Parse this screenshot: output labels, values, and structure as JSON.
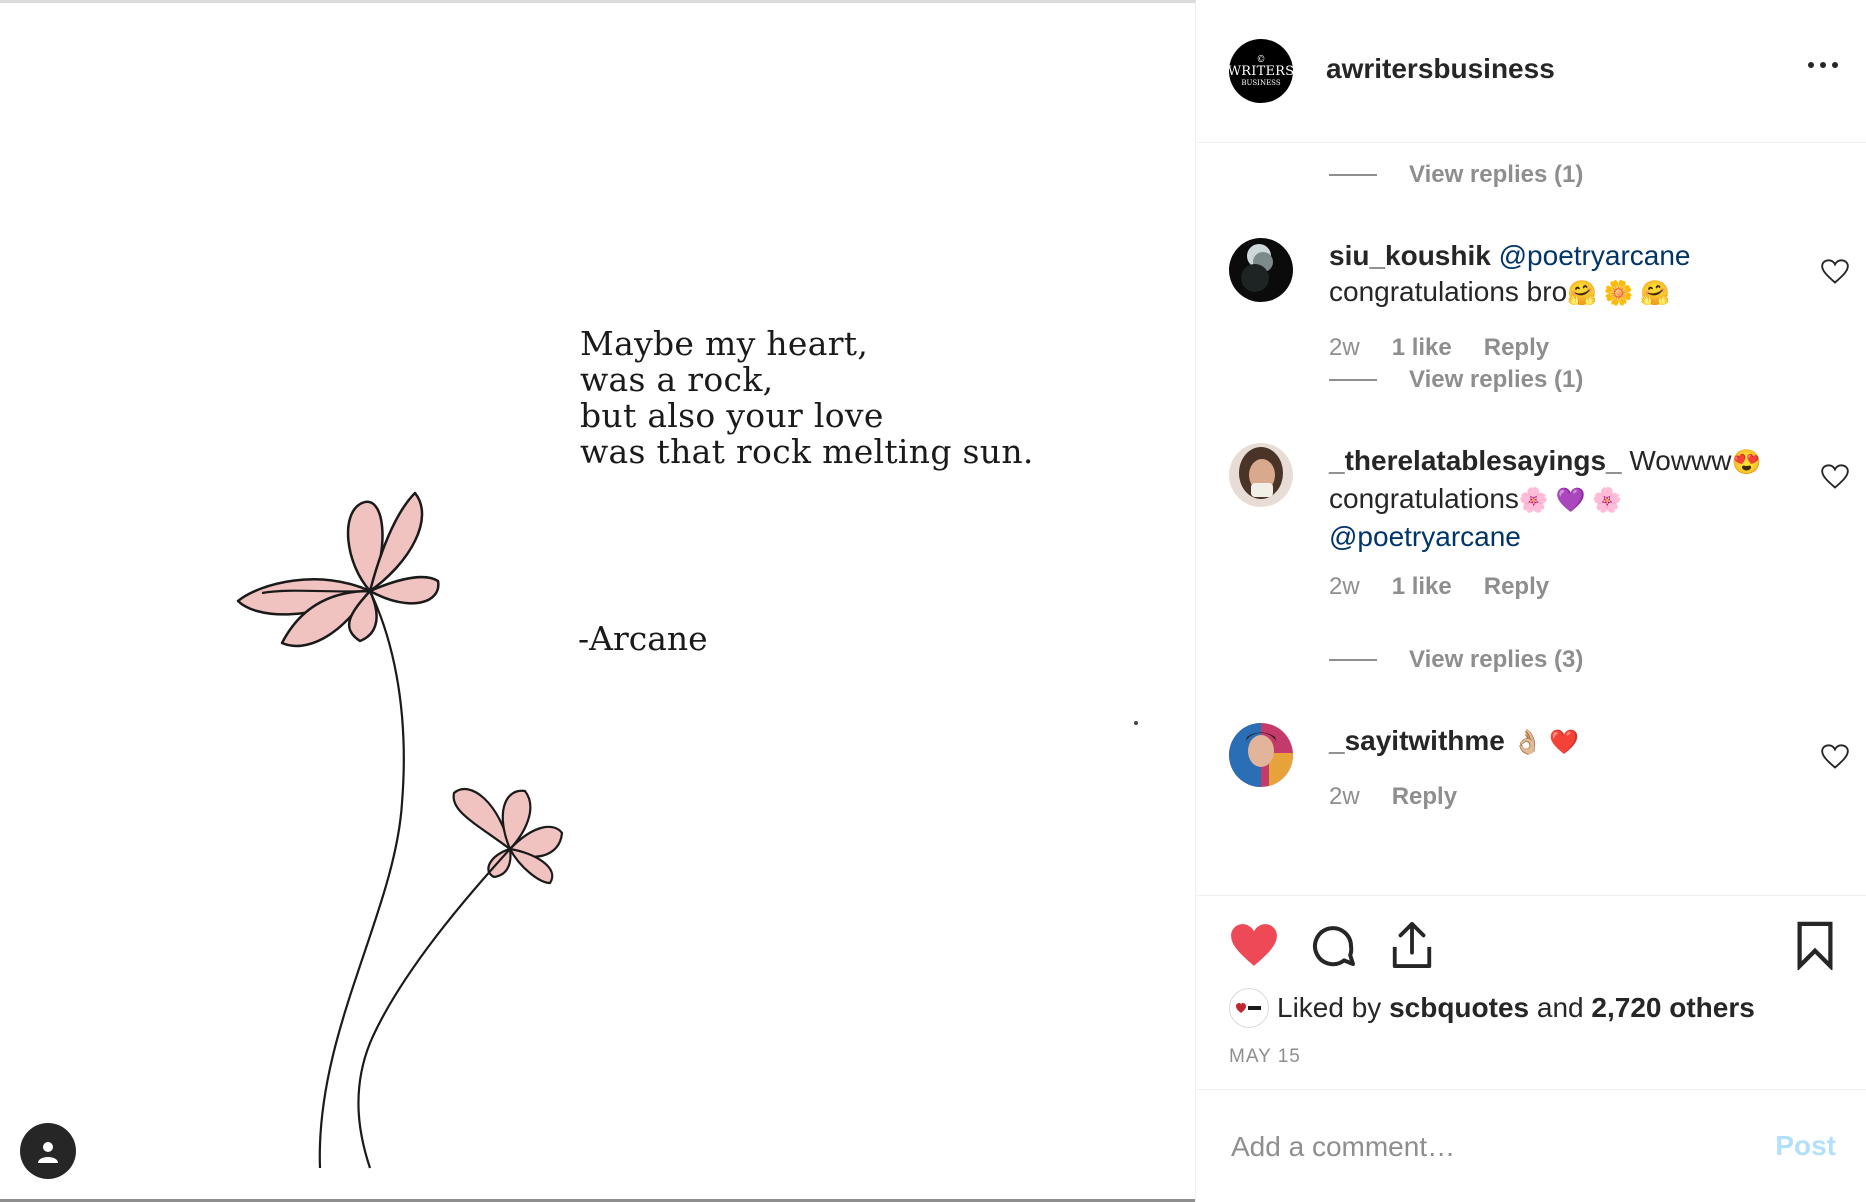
{
  "post": {
    "poem_lines": [
      "Maybe my heart,",
      "was a rock,",
      "but also your love",
      "was that rock melting sun."
    ],
    "signature": "-Arcane"
  },
  "header": {
    "username": "awritersbusiness",
    "avatar_lines": [
      "©",
      "WRITERS",
      "BUSINESS"
    ]
  },
  "comments": {
    "view_replies": [
      "View replies (1)",
      "View replies (1)",
      "View replies (3)"
    ],
    "items": [
      {
        "username": "siu_koushik",
        "mention": "@poetryarcane",
        "text": "congratulations bro",
        "emojis": "🤗 🌼 🤗",
        "time": "2w",
        "likes": "1 like",
        "reply": "Reply"
      },
      {
        "username": "_therelatablesayings_",
        "text_before": "Wowww",
        "emoji_1": "😍",
        "text_2": "congratulations",
        "emojis_2": "🌸 💜 🌸",
        "mention": "@poetryarcane",
        "time": "2w",
        "likes": "1 like",
        "reply": "Reply"
      },
      {
        "username": "_sayitwithme",
        "emojis": "👌🏼 ❤️",
        "time": "2w",
        "reply": "Reply"
      }
    ]
  },
  "actions": {
    "liked_prefix": "Liked by",
    "liked_user": "scbquotes",
    "liked_and": "and",
    "liked_others": "2,720 others",
    "date": "MAY 15"
  },
  "comment_box": {
    "placeholder": "Add a comment…",
    "post_label": "Post"
  },
  "colors": {
    "like_red": "#ed4956",
    "petal_pink": "#f0c2c0",
    "mention_blue": "#003569",
    "post_disabled": "#b2dffc"
  }
}
